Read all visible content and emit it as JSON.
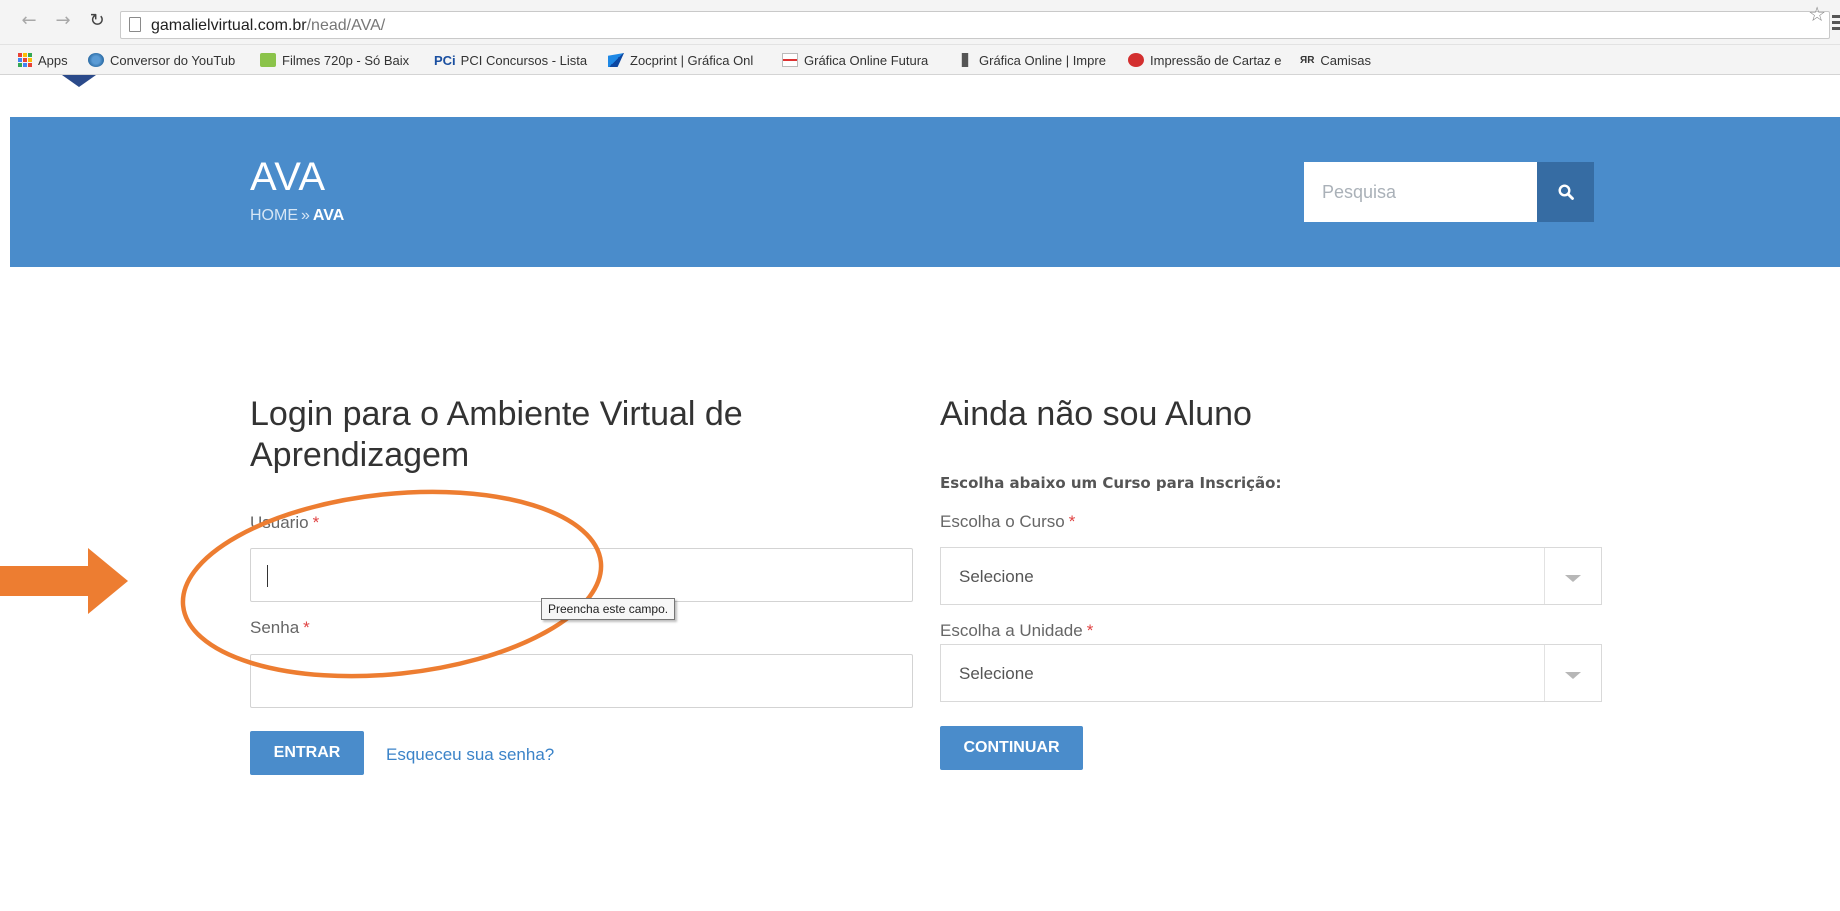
{
  "browser": {
    "url_domain": "gamalielvirtual.com.br",
    "url_path": "/nead/AVA/",
    "bookmarks": [
      {
        "label": "Apps",
        "icon": "apps-grid-icon"
      },
      {
        "label": "Conversor do YouTub",
        "icon": "converter-icon"
      },
      {
        "label": "Filmes 720p - Só Baix",
        "icon": "download-icon"
      },
      {
        "label": "PCI Concursos - Lista",
        "icon": "pci-icon"
      },
      {
        "label": "Zocprint | Gráfica Onl",
        "icon": "zocprint-icon"
      },
      {
        "label": "Gráfica Online Futura",
        "icon": "futura-icon"
      },
      {
        "label": "Gráfica Online | Impre",
        "icon": "print-icon"
      },
      {
        "label": "Impressão de Cartaz e",
        "icon": "poster-icon"
      },
      {
        "label": "Camisas",
        "icon": "shirt-icon"
      }
    ]
  },
  "header": {
    "title": "AVA",
    "breadcrumb": {
      "home": "HOME",
      "separator": "»",
      "current": "AVA"
    },
    "search": {
      "placeholder": "Pesquisa"
    },
    "background": "#4a8ccb"
  },
  "login": {
    "title": "Login para o Ambiente Virtual de Aprendizagem",
    "usuario_label": "Usuário",
    "senha_label": "Senha",
    "required_mark": "*",
    "usuario_value": "",
    "senha_value": "",
    "tooltip": "Preencha este campo.",
    "submit_label": "ENTRAR",
    "forgot_label": "Esqueceu sua senha?"
  },
  "signup": {
    "title": "Ainda não sou Aluno",
    "subtitle": "Escolha abaixo um Curso para Inscrição:",
    "curso_label": "Escolha o Curso",
    "curso_value": "Selecione",
    "unidade_label": "Escolha a Unidade",
    "unidade_value": "Selecione",
    "submit_label": "CONTINUAR"
  },
  "annotation": {
    "color": "#ed7d31"
  }
}
